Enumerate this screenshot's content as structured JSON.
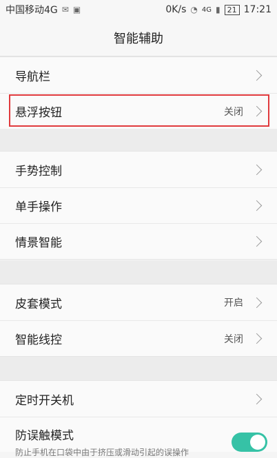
{
  "status_bar": {
    "carrier": "中国移动4G",
    "speed": "0K/s",
    "signal_label": "4G",
    "battery": "21",
    "time": "17:21"
  },
  "title": "智能辅助",
  "section1": {
    "items": [
      {
        "label": "导航栏",
        "value": ""
      },
      {
        "label": "悬浮按钮",
        "value": "关闭"
      }
    ]
  },
  "section2": {
    "items": [
      {
        "label": "手势控制",
        "value": ""
      },
      {
        "label": "单手操作",
        "value": ""
      },
      {
        "label": "情景智能",
        "value": ""
      }
    ]
  },
  "section3": {
    "items": [
      {
        "label": "皮套模式",
        "value": "开启"
      },
      {
        "label": "智能线控",
        "value": "关闭"
      }
    ]
  },
  "section4": {
    "items": [
      {
        "label": "定时开关机",
        "value": ""
      },
      {
        "label": "防误触模式",
        "value": ""
      }
    ],
    "pocket_mode_desc": "防止手机在口袋中由于挤压或滑动引起的误操作",
    "pocket_mode_enabled": true
  }
}
